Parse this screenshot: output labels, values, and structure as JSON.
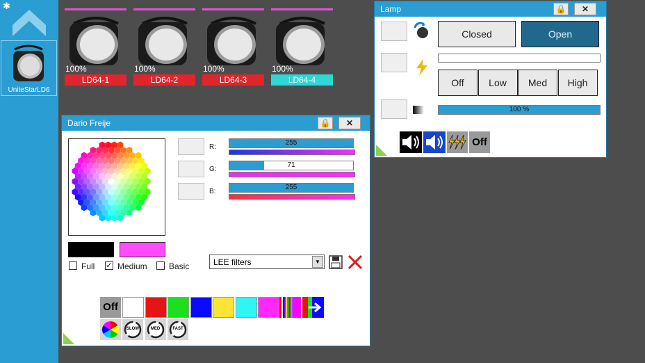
{
  "sidebar": {
    "device_label": "UniteStarLD6"
  },
  "fixtures": [
    {
      "percent": "100%",
      "name": "LD64-1",
      "color": "#e0262b"
    },
    {
      "percent": "100%",
      "name": "LD64-2",
      "color": "#e0262b"
    },
    {
      "percent": "100%",
      "name": "LD64-3",
      "color": "#e0262b"
    },
    {
      "percent": "100%",
      "name": "LD64-4",
      "color": "#30d5d5"
    }
  ],
  "color_window": {
    "title": "Dario Freije",
    "channels": [
      {
        "label": "R:",
        "value": "255",
        "level": 1.0
      },
      {
        "label": "G:",
        "value": "71",
        "level": 0.28
      },
      {
        "label": "B:",
        "value": "255",
        "level": 1.0
      }
    ],
    "modes": [
      {
        "label": "Full",
        "checked": false
      },
      {
        "label": "Medium",
        "checked": true
      },
      {
        "label": "Basic",
        "checked": false
      }
    ],
    "filter_select": "LEE filters",
    "current_color": "#ff4aff",
    "off_label": "Off",
    "swatches": [
      "#ffffff",
      "#e61515",
      "#1ddf1d",
      "#0a0aff",
      "#ffe533",
      "#2ff5f5",
      "#ff28ff"
    ],
    "speed_labels": [
      "SLOW",
      "MED",
      "FAST"
    ]
  },
  "lamp_window": {
    "title": "Lamp",
    "closed_label": "Closed",
    "open_label": "Open",
    "levels": [
      "Off",
      "Low",
      "Med",
      "High"
    ],
    "dimmer_value": "100 %",
    "dimmer_level": 1.0,
    "strobe_off_label": "Off"
  }
}
